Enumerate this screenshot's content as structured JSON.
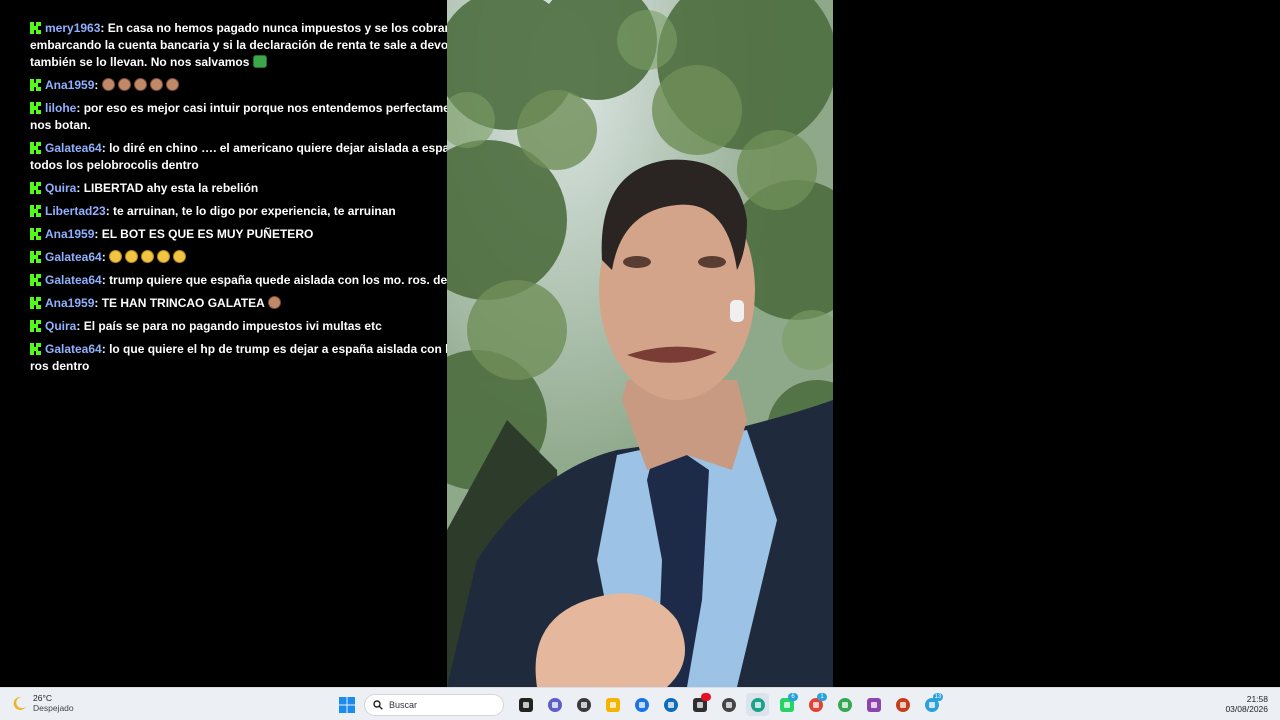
{
  "chat": {
    "messages": [
      {
        "user": "mery1963",
        "text": "En casa no hemos pagado nunca impuestos y se los cobran embarcando la cuenta bancaria y si la declaración de renta te sale a devolver también se lo llevan. No nos salvamos",
        "emojis": [
          "green"
        ]
      },
      {
        "user": "Ana1959",
        "text": "",
        "emojis": [
          "skin",
          "skin",
          "skin",
          "skin",
          "skin"
        ]
      },
      {
        "user": "lilohe",
        "text": "por eso es mejor casi intuir porque nos entendemos perfectamente sino nos botan.",
        "emojis": []
      },
      {
        "user": "Galatea64",
        "text": "lo diré en chino …. el americano quiere dejar aislada a españa con todos los pelobrocolis dentro",
        "emojis": []
      },
      {
        "user": "Quira",
        "text": "LIBERTAD ahy esta la rebelión",
        "emojis": []
      },
      {
        "user": "Libertad23",
        "text": "te arruinan, te lo digo por experiencia, te arruinan",
        "emojis": []
      },
      {
        "user": "Ana1959",
        "text": "EL BOT ES QUE ES MUY PUÑETERO",
        "emojis": []
      },
      {
        "user": "Galatea64",
        "text": "",
        "emojis": [
          "laugh",
          "laugh",
          "laugh",
          "laugh",
          "face"
        ]
      },
      {
        "user": "Galatea64",
        "text": "trump quiere que españa quede aislada con los mo. ros. dentro",
        "emojis": []
      },
      {
        "user": "Ana1959",
        "text": "TE HAN TRINCAO GALATEA",
        "emojis": [
          "skin"
        ]
      },
      {
        "user": "Quira",
        "text": "El país se para no pagando impuestos ivi multas etc",
        "emojis": []
      },
      {
        "user": "Galatea64",
        "text": "lo que quiere el hp de trump es dejar a españa aislada con los mo. ros dentro",
        "emojis": []
      }
    ]
  },
  "taskbar": {
    "weather": {
      "temp": "26°C",
      "condition": "Despejado"
    },
    "search_placeholder": "Buscar",
    "apps": [
      {
        "icon": "task-view-icon",
        "color": "#222222"
      },
      {
        "icon": "teams-icon",
        "color": "#5b5fc7"
      },
      {
        "icon": "media-app-icon",
        "color": "#3a3a3a"
      },
      {
        "icon": "file-explorer-icon",
        "color": "#f4b400"
      },
      {
        "icon": "store-icon",
        "color": "#1a73e8"
      },
      {
        "icon": "outlook-icon",
        "color": "#0f6cbd"
      },
      {
        "icon": "obs-icon",
        "color": "#302e31",
        "badge": ""
      },
      {
        "icon": "cube-app-icon",
        "color": "#444444"
      },
      {
        "icon": "edge-icon",
        "color": "#1ba28a",
        "active": true
      },
      {
        "icon": "whatsapp-icon",
        "color": "#25d366",
        "badge": "6"
      },
      {
        "icon": "chrome-profile-icon",
        "color": "#e34133",
        "badge": "1"
      },
      {
        "icon": "chrome-icon",
        "color": "#34a853"
      },
      {
        "icon": "app-circle-icon",
        "color": "#8e44ad"
      },
      {
        "icon": "powerpoint-icon",
        "color": "#c43e1c"
      },
      {
        "icon": "telegram-icon",
        "color": "#2aa1da",
        "badge": "13"
      }
    ],
    "clock": {
      "time": "21:58",
      "date": "03/08/2026"
    }
  }
}
